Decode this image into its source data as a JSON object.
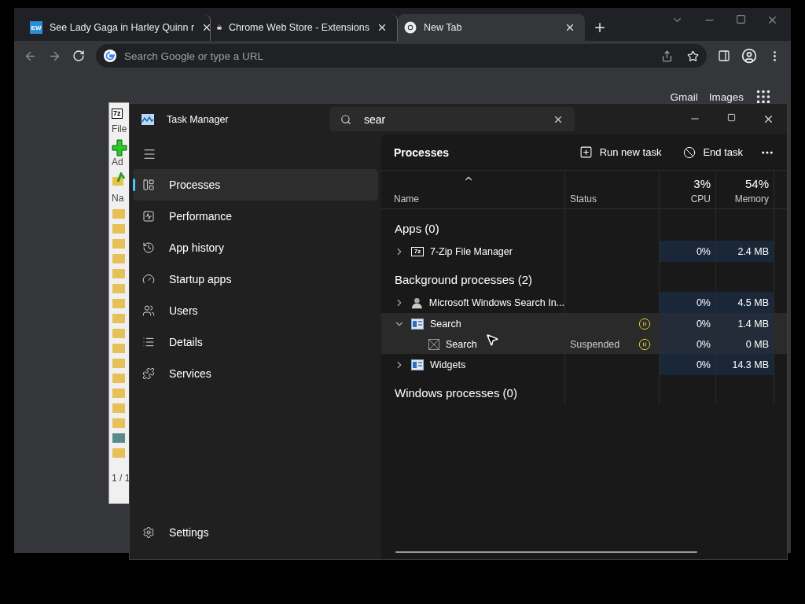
{
  "browser": {
    "tabs": [
      {
        "title": "See Lady Gaga in Harley Quinn r",
        "kind": "text",
        "favicon_text": "EW",
        "selected": false
      },
      {
        "title": "Chrome Web Store - Extensions",
        "kind": "store",
        "selected": false
      },
      {
        "title": "New Tab",
        "kind": "chrome",
        "selected": true
      }
    ],
    "address": {
      "placeholder": "Search Google or type a URL"
    },
    "links": [
      "Gmail",
      "Images"
    ]
  },
  "zip_window": {
    "logo": "7z",
    "menu": "File",
    "toolbar_label": "Ad",
    "column": "Na",
    "status": "1 / 1"
  },
  "task_manager": {
    "title": "Task Manager",
    "search": {
      "value": "sear"
    },
    "nav": [
      {
        "label": "Processes",
        "kind": "processes",
        "selected": true
      },
      {
        "label": "Performance",
        "kind": "performance",
        "selected": false
      },
      {
        "label": "App history",
        "kind": "history",
        "selected": false
      },
      {
        "label": "Startup apps",
        "kind": "startup",
        "selected": false
      },
      {
        "label": "Users",
        "kind": "users",
        "selected": false
      },
      {
        "label": "Details",
        "kind": "details",
        "selected": false
      },
      {
        "label": "Services",
        "kind": "services",
        "selected": false
      }
    ],
    "settings": "Settings",
    "page_title": "Processes",
    "actions": [
      {
        "label": "Run new task",
        "kind": "run"
      },
      {
        "label": "End task",
        "kind": "end"
      }
    ],
    "columns": {
      "name": "Name",
      "status": "Status",
      "cpu": {
        "total": "3%",
        "label": "CPU"
      },
      "memory": {
        "total": "54%",
        "label": "Memory"
      }
    },
    "groups": [
      {
        "title": "Apps (0)",
        "rows": [
          {
            "name": "7-Zip File Manager",
            "kind": "zip",
            "icon_text": "7z",
            "expanded": false,
            "selected": false,
            "paused": false,
            "cpu": "0%",
            "memory": "2.4 MB"
          }
        ]
      },
      {
        "title": "Background processes (2)",
        "rows": [
          {
            "name": "Microsoft Windows Search In...",
            "kind": "user",
            "expanded": false,
            "selected": false,
            "paused": false,
            "cpu": "0%",
            "memory": "4.5 MB"
          },
          {
            "name": "Search",
            "kind": "window",
            "expanded": true,
            "selected": true,
            "paused": true,
            "cpu": "0%",
            "memory": "1.4 MB",
            "children": [
              {
                "name": "Search",
                "kind": "blank",
                "status": "Suspended",
                "selected": true,
                "paused": true,
                "cpu": "0%",
                "memory": "0 MB"
              }
            ]
          },
          {
            "name": "Widgets",
            "kind": "window",
            "expanded": false,
            "selected": false,
            "paused": false,
            "cpu": "0%",
            "memory": "14.3 MB"
          }
        ]
      },
      {
        "title": "Windows processes (0)"
      }
    ]
  }
}
